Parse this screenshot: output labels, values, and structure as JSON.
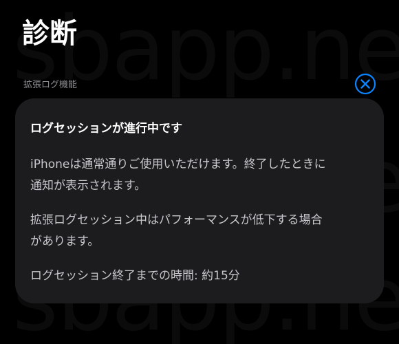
{
  "page_title": "診断",
  "section_label": "拡張ログ機能",
  "watermark_text": "sbapp.net",
  "close_icon": "xmark-circle-icon",
  "card": {
    "heading": "ログセッションが進行中です",
    "paragraph_1": "iPhoneは通常通りご使用いただけます。終了したときに\n通知が表示されます。",
    "paragraph_2": "拡張ログセッション中はパフォーマンスが低下する場合\nがあります。",
    "paragraph_3": "ログセッション終了までの時間: 約15分"
  },
  "colors": {
    "accent": "#0a84ff",
    "background": "#000000",
    "card": "#1c1c1e",
    "secondary_text": "#8e8e93"
  }
}
